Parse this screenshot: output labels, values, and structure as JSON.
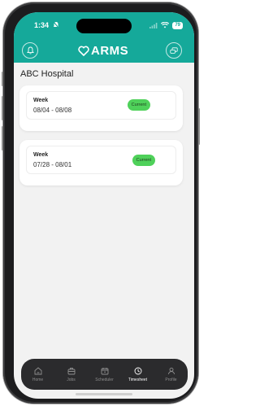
{
  "status": {
    "time": "1:34",
    "battery": "79"
  },
  "header": {
    "brand": "ARMS"
  },
  "page": {
    "title": "ABC Hospital"
  },
  "timesheets": [
    {
      "label": "Week",
      "range": "08/04 - 08/08",
      "badge": "Current"
    },
    {
      "label": "Week",
      "range": "07/28 - 08/01",
      "badge": "Current"
    }
  ],
  "tabbar": {
    "items": [
      {
        "label": "Home",
        "icon": "home-icon"
      },
      {
        "label": "Jobs",
        "icon": "briefcase-icon"
      },
      {
        "label": "Scheduler",
        "icon": "calendar-icon"
      },
      {
        "label": "Timesheet",
        "icon": "clock-icon",
        "active": true
      },
      {
        "label": "Profile",
        "icon": "user-icon"
      }
    ]
  },
  "colors": {
    "brand": "#15a99a",
    "badge": "#4fd15a",
    "tabbar": "#2b2b2d"
  }
}
